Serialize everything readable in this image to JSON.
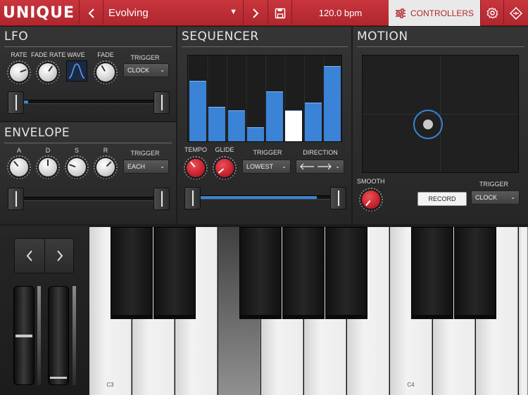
{
  "app": {
    "brand": "UNIQUE",
    "preset": "Evolving",
    "bpm": "120.0 bpm",
    "controllers": "CONTROLLERS"
  },
  "lfo": {
    "title": "LFO",
    "rate": "RATE",
    "fade_rate": "FADE RATE",
    "wave": "WAVE",
    "fade": "FADE",
    "trigger_label": "TRIGGER",
    "trigger_value": "CLOCK",
    "range_fill": 0.04
  },
  "envelope": {
    "title": "ENVELOPE",
    "a": "A",
    "d": "D",
    "s": "S",
    "r": "R",
    "trigger_label": "TRIGGER",
    "trigger_value": "EACH"
  },
  "sequencer": {
    "title": "SEQUENCER",
    "tempo": "TEMPO",
    "glide": "GLIDE",
    "trigger_label": "TRIGGER",
    "trigger_value": "LOWEST",
    "direction_label": "DIRECTION",
    "steps": [
      0.72,
      0.41,
      0.37,
      0.17,
      0.59,
      0.37,
      0.46,
      0.89
    ],
    "active_step": 5,
    "range_fill": 0.88
  },
  "motion": {
    "title": "MOTION",
    "smooth": "SMOOTH",
    "record": "RECORD",
    "trigger_label": "TRIGGER",
    "trigger_value": "CLOCK"
  },
  "keyboard": {
    "c3": "C3",
    "c4": "C4"
  },
  "colors": {
    "accent": "#c02c34",
    "blue": "#3a83d6"
  },
  "icons": [
    "chevron-left-icon",
    "chevron-right-icon",
    "chevron-down-icon",
    "save-icon",
    "sliders-icon",
    "gear-icon",
    "diamond-nav-icon",
    "arrow-both-icon"
  ]
}
